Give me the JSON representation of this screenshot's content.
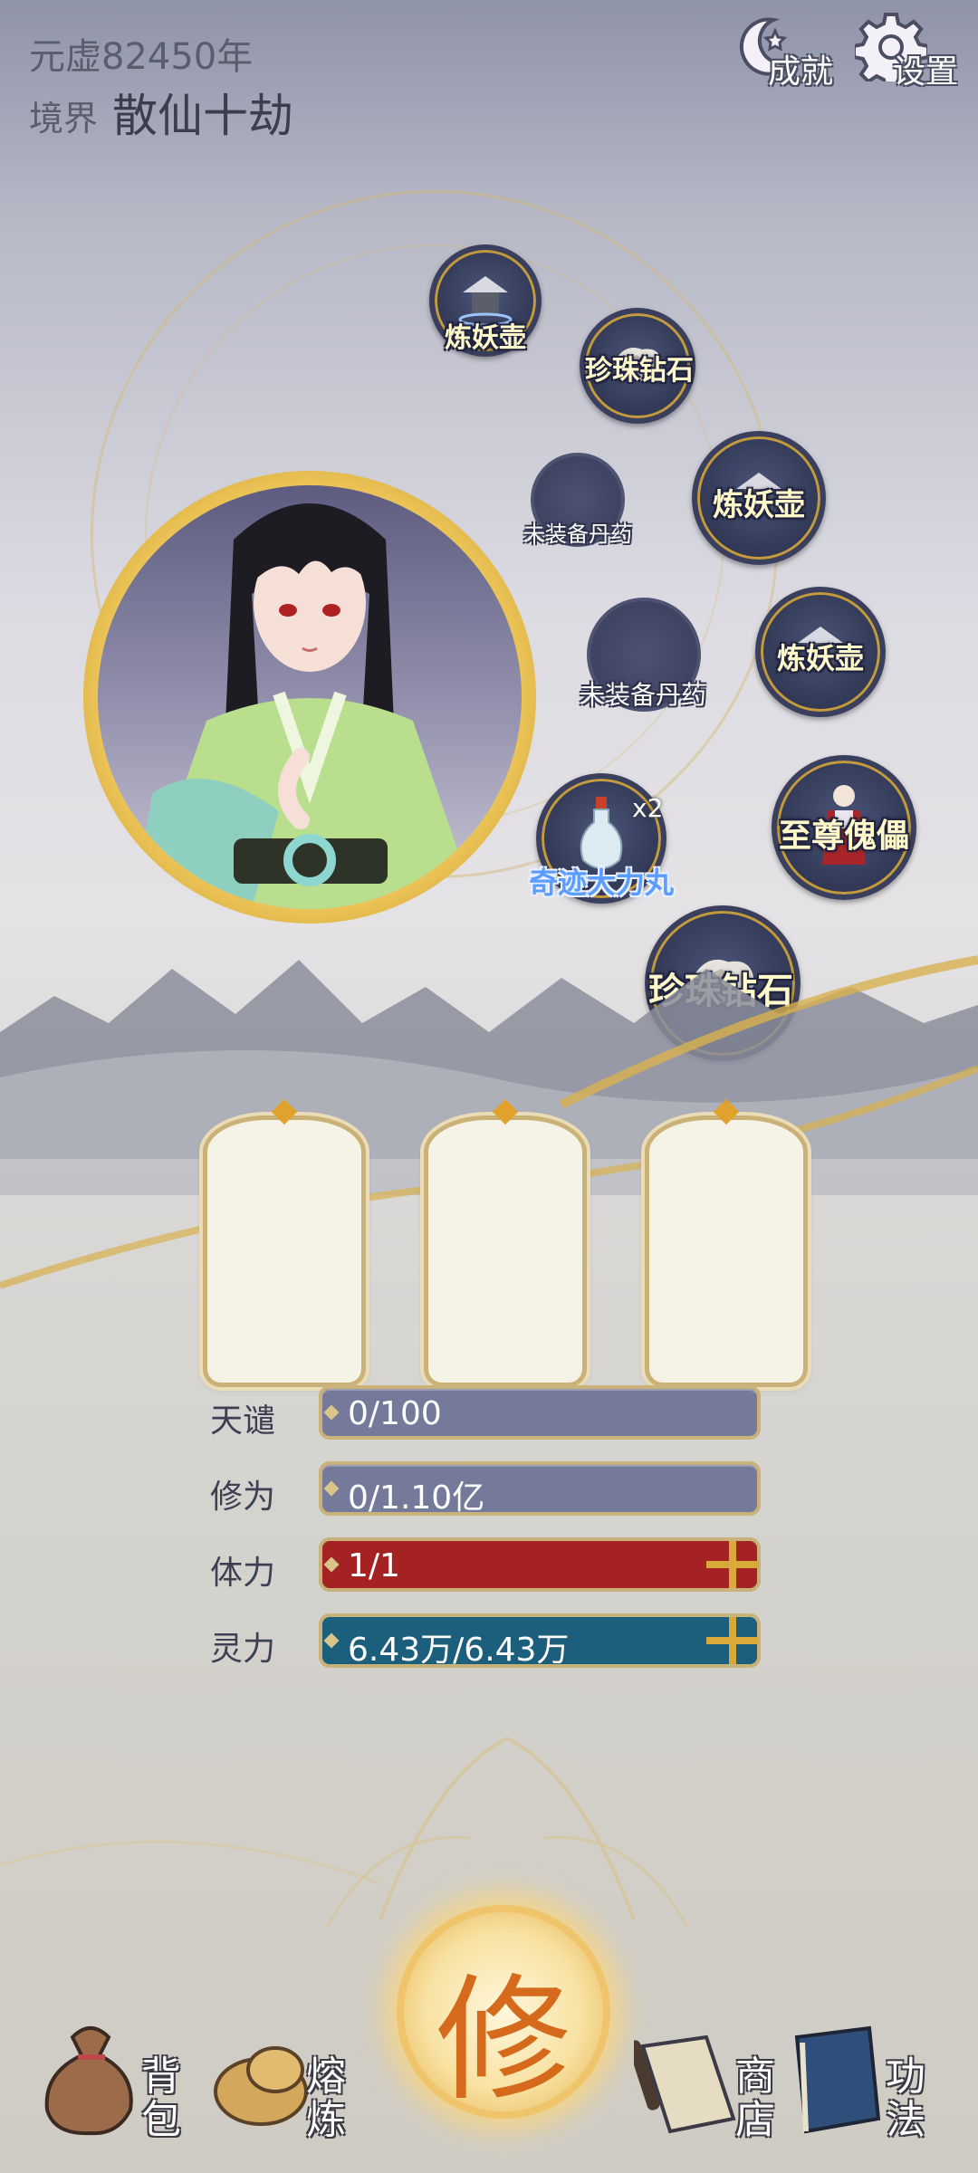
{
  "header": {
    "era": "元虚82450年",
    "realm_label": "境界",
    "realm_value": "散仙十劫",
    "achievement_label": "成就",
    "settings_label": "设置"
  },
  "items": [
    {
      "name": "炼妖壶"
    },
    {
      "name": "珍珠钻石"
    },
    {
      "name": "未装备丹药"
    },
    {
      "name": "炼妖壶"
    },
    {
      "name": "未装备丹药"
    },
    {
      "name": "炼妖壶"
    },
    {
      "name": "奇迹大力丸",
      "count": "x2"
    },
    {
      "name": "至尊傀儡"
    },
    {
      "name": "珍珠钻石"
    }
  ],
  "stats": [
    {
      "label": "天谴",
      "value": "0/100",
      "fill": 0
    },
    {
      "label": "修为",
      "value": "0/1.10亿",
      "fill": 0
    },
    {
      "label": "体力",
      "value": "1/1",
      "fill": 1
    },
    {
      "label": "灵力",
      "value": "6.43万/6.43万",
      "fill": 1
    }
  ],
  "colors": {
    "bar_empty": "#767a9a",
    "stamina": "#a42222",
    "spirit": "#1b5f7d",
    "gold": "#d9a93a"
  },
  "bottom_nav": {
    "cultivate_label": "修",
    "bag": "背包",
    "refine": "熔炼",
    "shop": "商店",
    "skills": "功法"
  }
}
